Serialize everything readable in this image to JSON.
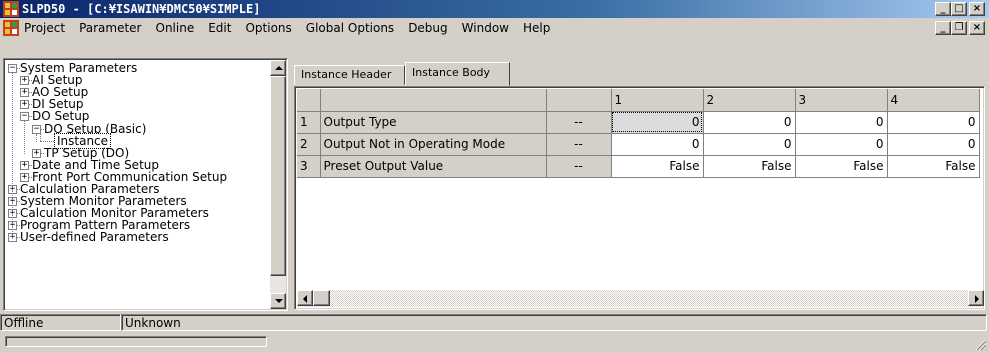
{
  "window": {
    "title": "SLPD50 - [C:¥ISAWIN¥DMC50¥SIMPLE]"
  },
  "menu": [
    "Project",
    "Parameter",
    "Online",
    "Edit",
    "Options",
    "Global Options",
    "Debug",
    "Window",
    "Help"
  ],
  "tree": {
    "items": [
      {
        "label": "System Parameters",
        "level": 0,
        "expander": "-"
      },
      {
        "label": "AI Setup",
        "level": 1,
        "expander": "+"
      },
      {
        "label": "AO Setup",
        "level": 1,
        "expander": "+"
      },
      {
        "label": "DI Setup",
        "level": 1,
        "expander": "+"
      },
      {
        "label": "DO Setup",
        "level": 1,
        "expander": "-"
      },
      {
        "label": "DO Setup (Basic)",
        "level": 2,
        "expander": "-"
      },
      {
        "label": "Instance",
        "level": 3,
        "expander": ""
      },
      {
        "label": "TP Setup (DO)",
        "level": 2,
        "expander": "+"
      },
      {
        "label": "Date and Time Setup",
        "level": 1,
        "expander": "+"
      },
      {
        "label": "Front Port Communication Setup",
        "level": 1,
        "expander": "+"
      },
      {
        "label": "Calculation Parameters",
        "level": 0,
        "expander": "+"
      },
      {
        "label": "System Monitor Parameters",
        "level": 0,
        "expander": "+"
      },
      {
        "label": "Calculation Monitor Parameters",
        "level": 0,
        "expander": "+"
      },
      {
        "label": "Program Pattern Parameters",
        "level": 0,
        "expander": "+"
      },
      {
        "label": "User-defined Parameters",
        "level": 0,
        "expander": "+"
      }
    ]
  },
  "tabs": [
    "Instance Header",
    "Instance Body"
  ],
  "active_tab": "Instance Body",
  "grid": {
    "columns": [
      "1",
      "2",
      "3",
      "4"
    ],
    "rows": [
      {
        "num": "1",
        "name": "Output Type",
        "unit": "--",
        "values": [
          "0",
          "0",
          "0",
          "0"
        ]
      },
      {
        "num": "2",
        "name": "Output Not in Operating Mode",
        "unit": "--",
        "values": [
          "0",
          "0",
          "0",
          "0"
        ]
      },
      {
        "num": "3",
        "name": "Preset Output Value",
        "unit": "--",
        "values": [
          "False",
          "False",
          "False",
          "False"
        ]
      }
    ]
  },
  "status": {
    "connection": "Offline",
    "device": "Unknown"
  }
}
